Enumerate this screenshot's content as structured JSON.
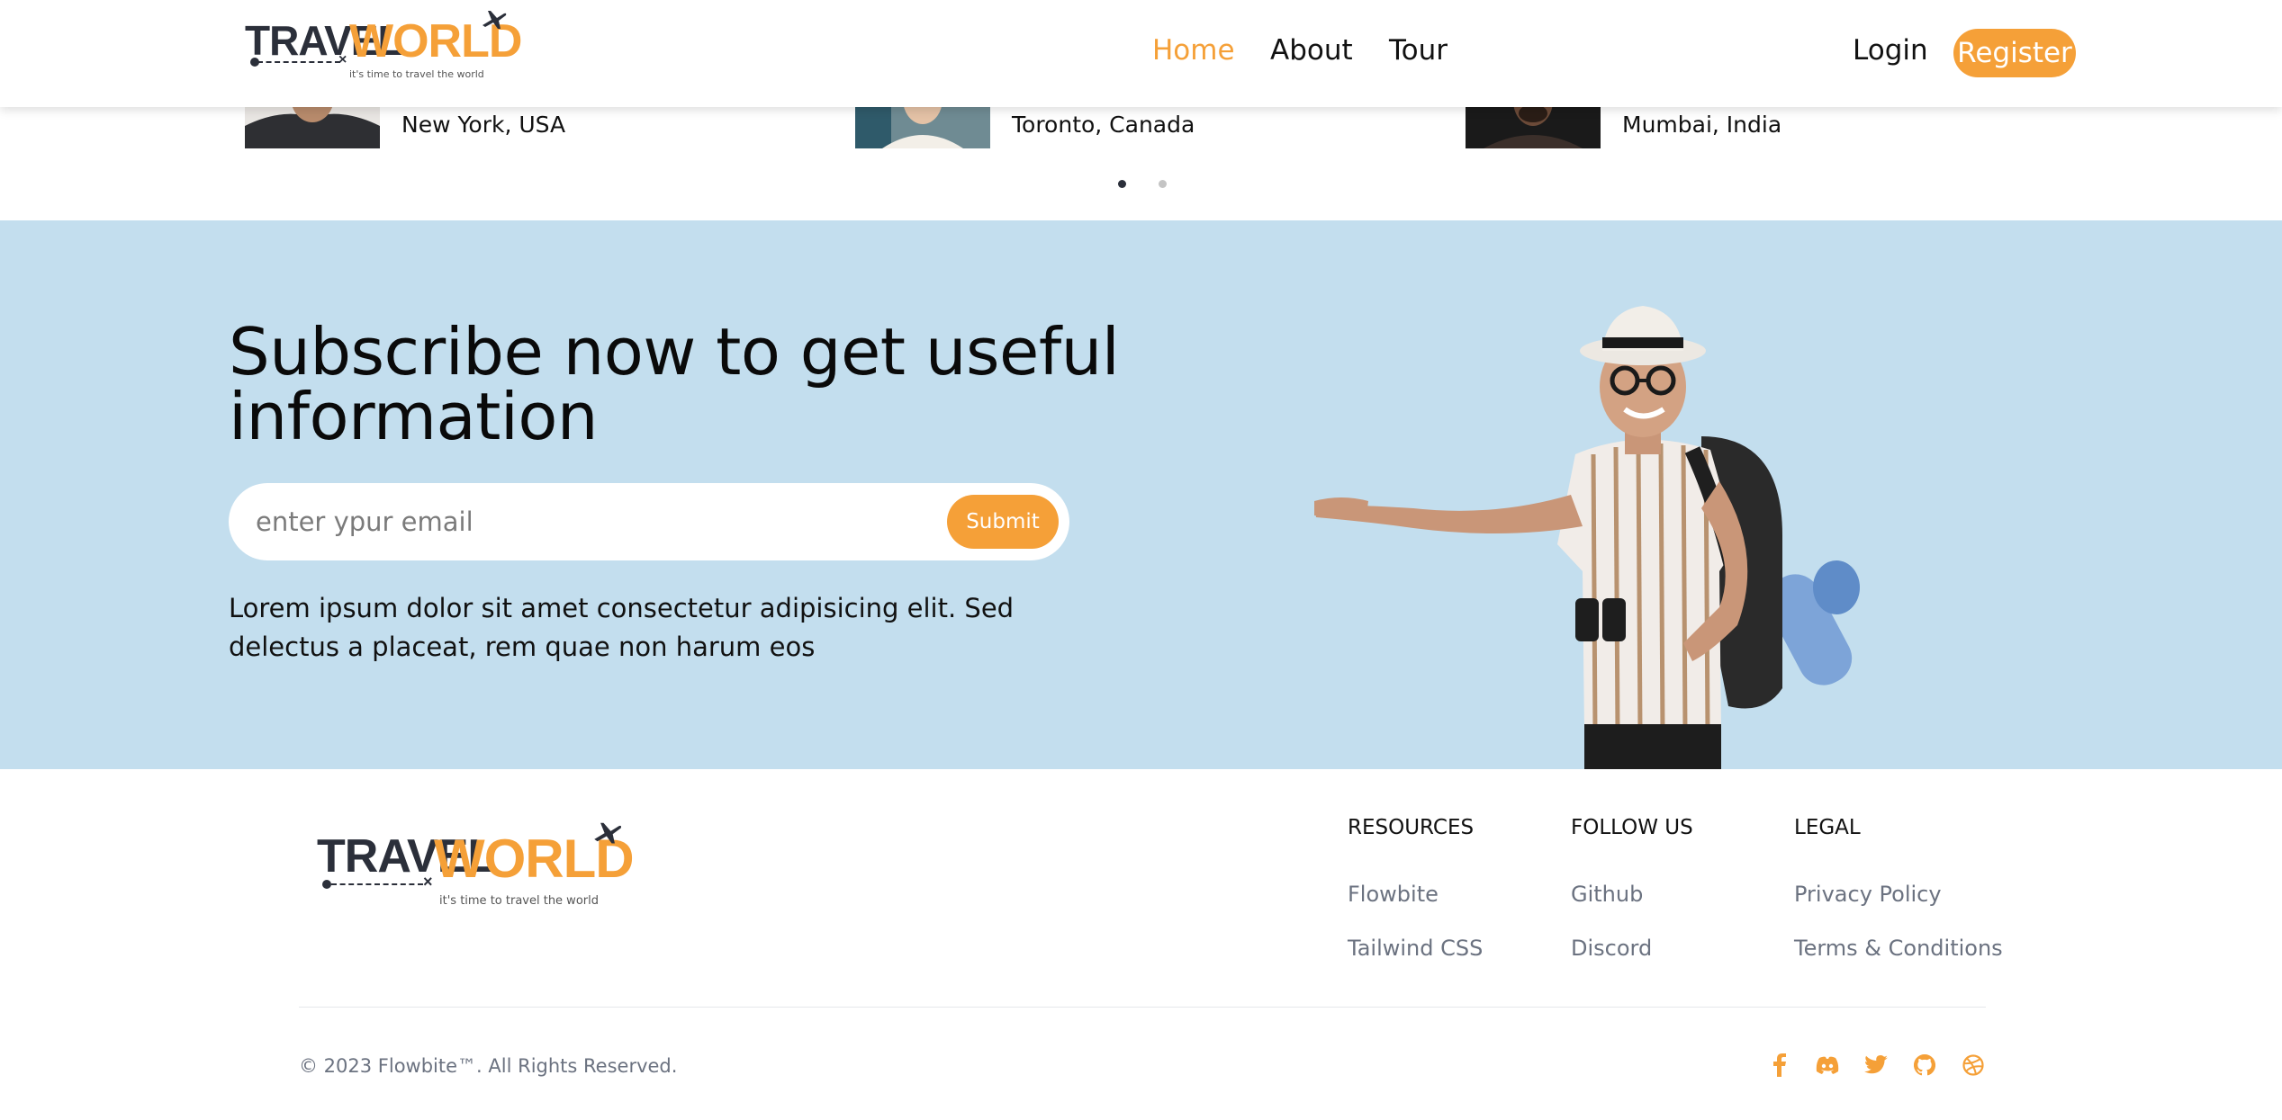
{
  "brand": {
    "logo_travel": "TRAVEL",
    "logo_world": "WORLD",
    "tagline": "it's time to travel the world",
    "accent": "#f5a038",
    "dark": "#2b2f3a"
  },
  "nav": {
    "items": [
      {
        "label": "Home",
        "active": true
      },
      {
        "label": "About",
        "active": false
      },
      {
        "label": "Tour",
        "active": false
      }
    ],
    "login": "Login",
    "register": "Register"
  },
  "testimonials": {
    "items": [
      {
        "location": "New York, USA"
      },
      {
        "location": "Toronto, Canada"
      },
      {
        "location": "Mumbai, India"
      }
    ],
    "page_count": 2,
    "active_page": 1
  },
  "subscribe": {
    "background": "#c3deee",
    "title": "Subscribe now to get useful information",
    "email_placeholder": "enter ypur email",
    "submit_label": "Submit",
    "description": "Lorem ipsum dolor sit amet consectetur adipisicing elit. Sed delectus a placeat, rem quae non harum eos"
  },
  "footer": {
    "columns": [
      {
        "title": "RESOURCES",
        "links": [
          "Flowbite",
          "Tailwind CSS"
        ]
      },
      {
        "title": "FOLLOW US",
        "links": [
          "Github",
          "Discord"
        ]
      },
      {
        "title": "LEGAL",
        "links": [
          "Privacy Policy",
          "Terms & Conditions"
        ]
      }
    ],
    "copyright": "© 2023 Flowbite™. All Rights Reserved.",
    "social_icons": [
      "facebook-icon",
      "discord-icon",
      "twitter-icon",
      "github-icon",
      "dribbble-icon"
    ]
  }
}
